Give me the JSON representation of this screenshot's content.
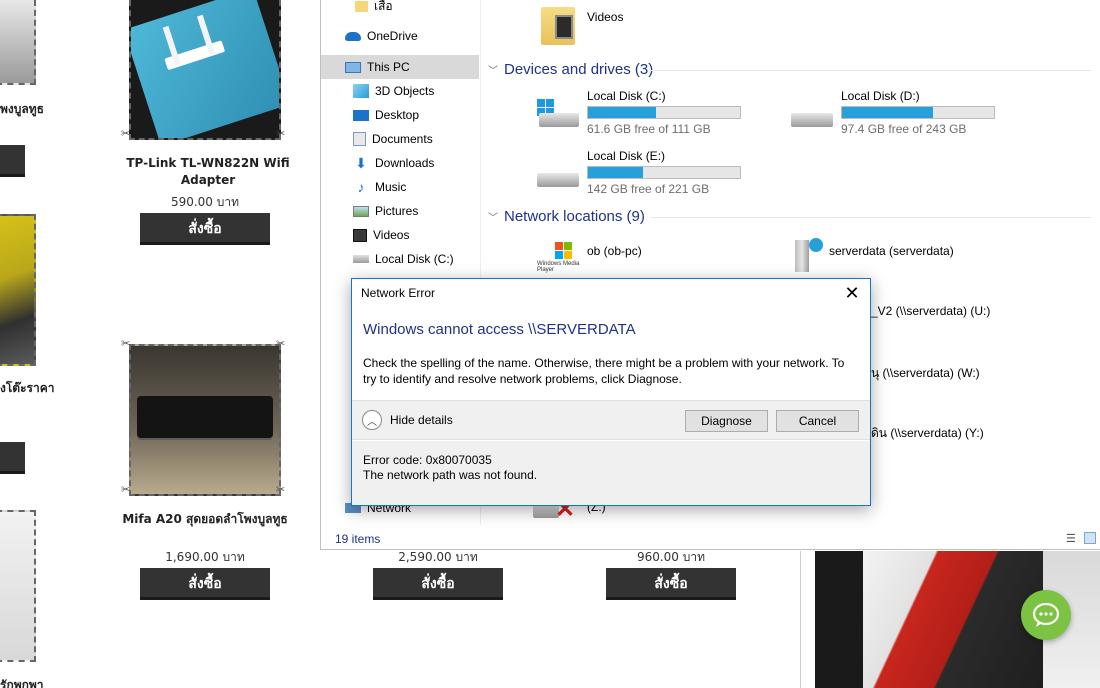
{
  "shop": {
    "fragments": {
      "left_top": "พงบูลทูธ",
      "left_mid": "งโต๊ะราคา",
      "left_bottom": "รักพกพา"
    },
    "products": [
      {
        "name": "TP-Link TL-WN822N Wifi Adapter",
        "price": "590.00 บาท",
        "buy_label": "สั่งซื้อ"
      },
      {
        "name": "Mifa A20 สุดยอดลำโพงบูลทูธ",
        "price": "1,690.00 บาท",
        "buy_label": "สั่งซื้อ"
      },
      {
        "name": "",
        "price": "2,590.00 บาท",
        "buy_label": "สั่งซื้อ"
      },
      {
        "name": "",
        "price": "960.00 บาท",
        "buy_label": "สั่งซื้อ"
      }
    ]
  },
  "explorer": {
    "nav": [
      {
        "label": "เสือ",
        "icon": "folder-icon"
      },
      {
        "label": "OneDrive",
        "icon": "cloud-icon"
      },
      {
        "label": "This PC",
        "icon": "computer-icon",
        "selected": true
      },
      {
        "label": "3D Objects",
        "icon": "cube-icon"
      },
      {
        "label": "Desktop",
        "icon": "desktop-icon"
      },
      {
        "label": "Documents",
        "icon": "documents-icon"
      },
      {
        "label": "Downloads",
        "icon": "download-icon"
      },
      {
        "label": "Music",
        "icon": "music-icon"
      },
      {
        "label": "Pictures",
        "icon": "pictures-icon"
      },
      {
        "label": "Videos",
        "icon": "videos-icon"
      },
      {
        "label": "Local Disk (C:)",
        "icon": "drive-icon"
      },
      {
        "label": "Network",
        "icon": "network-icon"
      }
    ],
    "folder_videos": "Videos",
    "devices_header": "Devices and drives (3)",
    "drives": [
      {
        "name": "Local Disk (C:)",
        "free": "61.6 GB free of 111 GB",
        "used_fraction": 0.45
      },
      {
        "name": "Local Disk (D:)",
        "free": "97.4 GB free of 243 GB",
        "used_fraction": 0.6
      },
      {
        "name": "Local Disk (E:)",
        "free": "142 GB free of 221 GB",
        "used_fraction": 0.36
      }
    ],
    "network_header": "Network locations (9)",
    "network_items": [
      {
        "label": "ob (ob-pc)",
        "sub": "Windows Media Player"
      },
      {
        "label": "serverdata (serverdata)"
      },
      {
        "label": "_V2 (\\\\serverdata) (U:)"
      },
      {
        "label": "นุ (\\\\serverdata) (W:)"
      },
      {
        "label": "ดิน (\\\\serverdata) (Y:)"
      },
      {
        "label": "(Z:)"
      }
    ],
    "status": "19 items"
  },
  "dialog": {
    "title": "Network Error",
    "close_glyph": "✕",
    "heading": "Windows cannot access \\\\SERVERDATA",
    "message": "Check the spelling of the name. Otherwise, there might be a problem with your network. To try to identify and resolve network problems, click Diagnose.",
    "hide_details": "Hide details",
    "diagnose": "Diagnose",
    "cancel": "Cancel",
    "error_code": "Error code: 0x80070035",
    "error_desc": "The network path was not found."
  },
  "colors": {
    "accent_blue": "#1e3287",
    "drive_fill": "#26a0da",
    "chat_green": "#7cc243"
  }
}
